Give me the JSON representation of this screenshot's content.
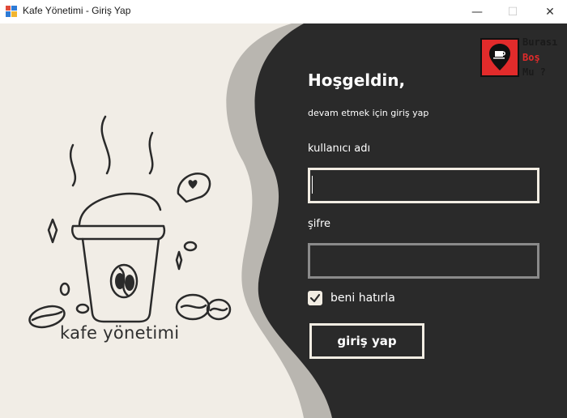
{
  "window": {
    "title": "Kafe Yönetimi - Giriş Yap",
    "minimize_glyph": "—",
    "maximize_glyph": "☐",
    "close_glyph": "✕"
  },
  "brand": {
    "text": "kafe yönetimi"
  },
  "logo": {
    "line1": "Burası",
    "line2": "Boş",
    "line3": "Mu ?",
    "icon": "map-pin-cup-icon",
    "accent_color": "#e22b2b"
  },
  "login": {
    "welcome": "Hoşgeldin,",
    "subtitle": "devam etmek için giriş yap",
    "username_label": "kullanıcı adı",
    "username_value": "",
    "password_label": "şifre",
    "password_value": "",
    "remember_label": "beni hatırla",
    "remember_checked": true,
    "submit_label": "giriş yap"
  },
  "colors": {
    "dark_panel": "#2a2a2a",
    "light_panel": "#f1ede6",
    "wave_gray": "#b9b6b0"
  }
}
